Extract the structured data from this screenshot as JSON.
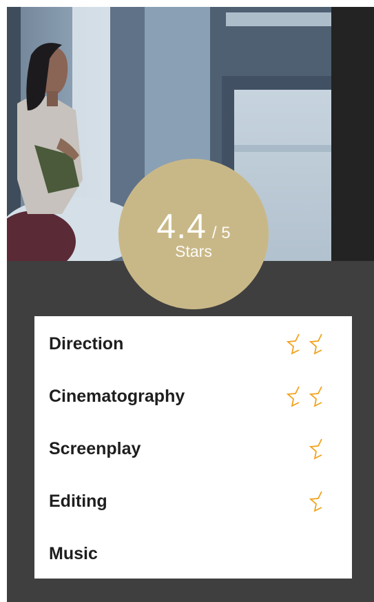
{
  "rating": {
    "score": "4.4",
    "max": "/ 5",
    "unit": "Stars",
    "value": 4.4,
    "out_of": 5
  },
  "criteria": [
    {
      "label": "Direction",
      "stars": 2
    },
    {
      "label": "Cinematography",
      "stars": 2
    },
    {
      "label": "Screenplay",
      "stars": 1
    },
    {
      "label": "Editing",
      "stars": 1
    },
    {
      "label": "Music",
      "stars": 0
    }
  ],
  "colors": {
    "frame_bg": "#3f3f3f",
    "badge_gold": "#c9b887",
    "star_orange": "#f2a21b",
    "label_text": "#1e1e1e"
  },
  "icons": {
    "star": "half-star-outline-icon"
  },
  "hero_image": "movie still of a woman sitting by a window"
}
